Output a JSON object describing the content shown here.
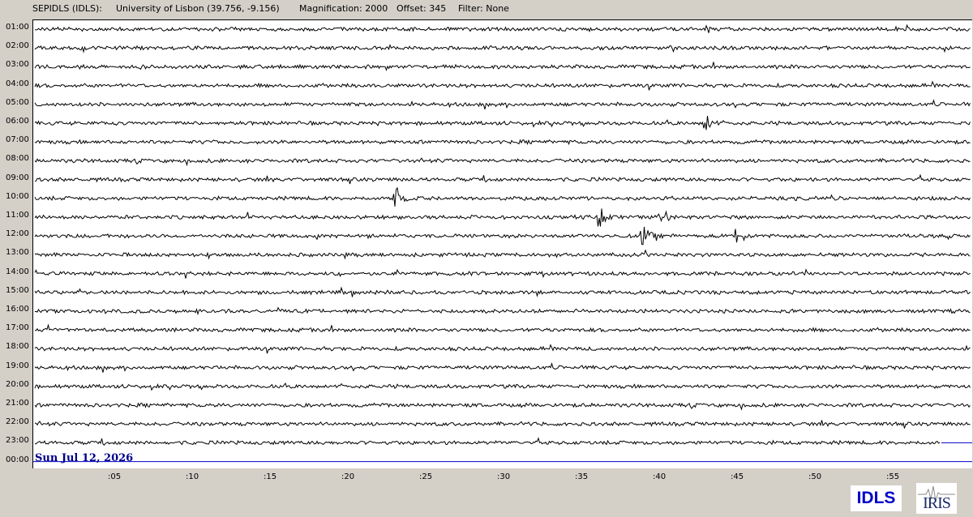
{
  "header": {
    "station": "SEPIDLS (IDLS):",
    "location": "University of Lisbon (39.756, -9.156)",
    "magnification": "Magnification: 2000",
    "offset": "Offset: 345",
    "filter": "Filter: None"
  },
  "hour_labels": [
    "01:00",
    "02:00",
    "03:00",
    "04:00",
    "05:00",
    "06:00",
    "07:00",
    "08:00",
    "09:00",
    "10:00",
    "11:00",
    "12:00",
    "13:00",
    "14:00",
    "15:00",
    "16:00",
    "17:00",
    "18:00",
    "19:00",
    "20:00",
    "21:00",
    "22:00",
    "23:00",
    "00:00"
  ],
  "minute_labels": [
    ":05",
    ":10",
    ":15",
    ":20",
    ":25",
    ":30",
    ":35",
    ":40",
    ":45",
    ":50",
    ":55"
  ],
  "date_label": "Sun Jul 12, 2026",
  "logos": {
    "idls": "IDLS",
    "iris": "IRIS"
  },
  "colors": {
    "trace": "#000000",
    "current_line": "#0000c8",
    "date_text": "#00008b",
    "background": "#d4d0c8"
  },
  "seismic_events": [
    {
      "hour": "06:00",
      "minute": 43.0
    },
    {
      "hour": "10:00",
      "minute": 23.2
    },
    {
      "hour": "11:00",
      "minute": 36.3
    },
    {
      "hour": "11:00",
      "minute": 40.2
    },
    {
      "hour": "12:00",
      "minute": 39.0
    },
    {
      "hour": "12:00",
      "minute": 45.1
    }
  ]
}
